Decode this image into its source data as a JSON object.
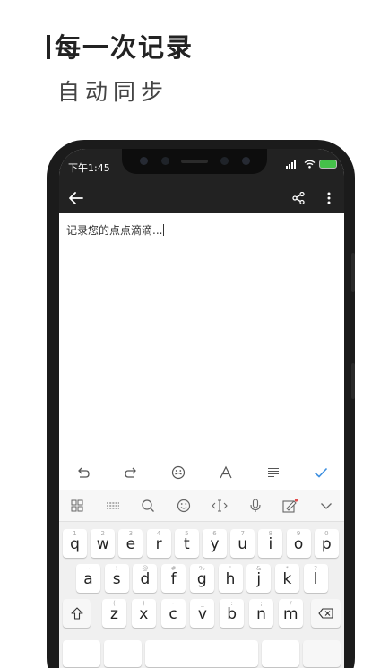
{
  "promo": {
    "title": "每一次记录",
    "subtitle": "自动同步"
  },
  "status_bar": {
    "time": "下午1:45",
    "signal": "░ıl",
    "battery_color": "#45c14a"
  },
  "app_bar": {
    "back_icon": "arrow-left-icon",
    "share_icon": "share-icon",
    "more_icon": "more-vertical-icon"
  },
  "note": {
    "content": "记录您的点点滴滴..."
  },
  "edit_toolbar": [
    {
      "name": "undo",
      "icon": "undo-icon"
    },
    {
      "name": "redo",
      "icon": "redo-icon"
    },
    {
      "name": "mood",
      "icon": "emoji-icon"
    },
    {
      "name": "text-format",
      "icon": "font-icon"
    },
    {
      "name": "align",
      "icon": "align-icon"
    },
    {
      "name": "done",
      "icon": "check-icon"
    }
  ],
  "keyboard": {
    "top_row": [
      {
        "name": "menu-grid",
        "icon": "grid-icon"
      },
      {
        "name": "keyboard-switch",
        "icon": "keyboard-icon"
      },
      {
        "name": "search",
        "icon": "search-icon"
      },
      {
        "name": "emoji",
        "icon": "smile-icon"
      },
      {
        "name": "cursor",
        "icon": "cursor-icon"
      },
      {
        "name": "voice",
        "icon": "microphone-icon"
      },
      {
        "name": "handwriting",
        "icon": "pen-icon"
      },
      {
        "name": "collapse",
        "icon": "chevron-down-icon"
      }
    ],
    "row1": [
      {
        "key": "q",
        "hint": "1"
      },
      {
        "key": "w",
        "hint": "2"
      },
      {
        "key": "e",
        "hint": "3"
      },
      {
        "key": "r",
        "hint": "4"
      },
      {
        "key": "t",
        "hint": "5"
      },
      {
        "key": "y",
        "hint": "6"
      },
      {
        "key": "u",
        "hint": "7"
      },
      {
        "key": "i",
        "hint": "8"
      },
      {
        "key": "o",
        "hint": "9"
      },
      {
        "key": "p",
        "hint": "0"
      }
    ],
    "row2": [
      {
        "key": "a",
        "hint": "~"
      },
      {
        "key": "s",
        "hint": "!"
      },
      {
        "key": "d",
        "hint": "@"
      },
      {
        "key": "f",
        "hint": "#"
      },
      {
        "key": "g",
        "hint": "%"
      },
      {
        "key": "h",
        "hint": "'"
      },
      {
        "key": "j",
        "hint": "&"
      },
      {
        "key": "k",
        "hint": "*"
      },
      {
        "key": "l",
        "hint": "?"
      }
    ],
    "row3": [
      {
        "key": "z",
        "hint": "("
      },
      {
        "key": "x",
        "hint": ")"
      },
      {
        "key": "c",
        "hint": "-"
      },
      {
        "key": "v",
        "hint": "_"
      },
      {
        "key": "b",
        "hint": ":"
      },
      {
        "key": "n",
        "hint": ";"
      },
      {
        "key": "m",
        "hint": "/"
      }
    ],
    "shift_icon": "shift-arrow-icon",
    "backspace_icon": "backspace-icon"
  }
}
